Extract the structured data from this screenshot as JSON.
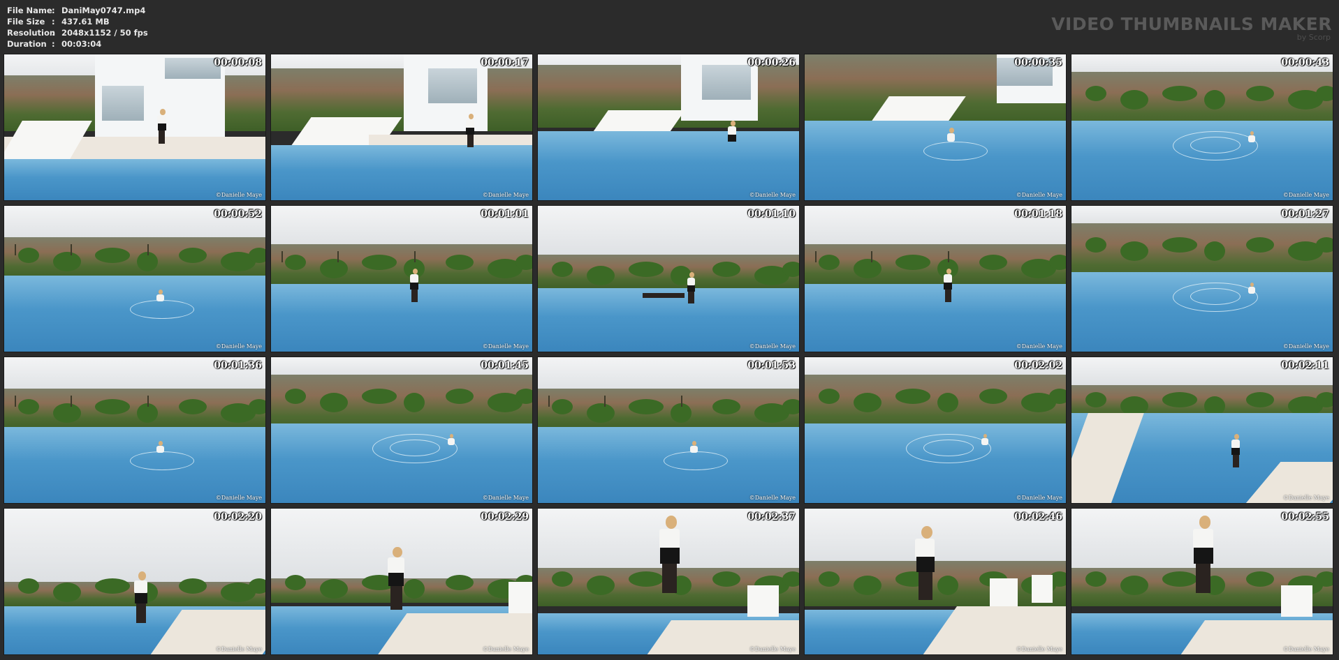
{
  "file_info": {
    "rows": [
      {
        "key": "File Name",
        "sep": ":",
        "value": "DaniMay0747.mp4"
      },
      {
        "key": "File Size",
        "sep": ":",
        "value": "437.61 MB"
      },
      {
        "key": "Resolution",
        "sep": ":",
        "value": "2048x1152 / 50 fps"
      },
      {
        "key": "Duration",
        "sep": ":",
        "value": "00:03:04"
      }
    ]
  },
  "brand": {
    "title": "VIDEO THUMBNAILS MAKER",
    "subtitle": "by Scorp"
  },
  "thumbnails": [
    {
      "timestamp": "00:00:08",
      "watermark": "©Danielle Maye",
      "scene": "house-standing"
    },
    {
      "timestamp": "00:00:17",
      "watermark": "©Danielle Maye",
      "scene": "house-steps"
    },
    {
      "timestamp": "00:00:26",
      "watermark": "©Danielle Maye",
      "scene": "house-wading"
    },
    {
      "timestamp": "00:00:35",
      "watermark": "©Danielle Maye",
      "scene": "house-deeper"
    },
    {
      "timestamp": "00:00:43",
      "watermark": "©Danielle Maye",
      "scene": "swim-ripple"
    },
    {
      "timestamp": "00:00:52",
      "watermark": "©Danielle Maye",
      "scene": "swim"
    },
    {
      "timestamp": "00:01:01",
      "watermark": "©Danielle Maye",
      "scene": "edge-sit"
    },
    {
      "timestamp": "00:01:10",
      "watermark": "©Danielle Maye",
      "scene": "edge-lounge"
    },
    {
      "timestamp": "00:01:18",
      "watermark": "©Danielle Maye",
      "scene": "edge-sit"
    },
    {
      "timestamp": "00:01:27",
      "watermark": "©Danielle Maye",
      "scene": "swim-ripple"
    },
    {
      "timestamp": "00:01:36",
      "watermark": "©Danielle Maye",
      "scene": "swim"
    },
    {
      "timestamp": "00:01:45",
      "watermark": "©Danielle Maye",
      "scene": "swim-ripple"
    },
    {
      "timestamp": "00:01:53",
      "watermark": "©Danielle Maye",
      "scene": "swim"
    },
    {
      "timestamp": "00:02:02",
      "watermark": "©Danielle Maye",
      "scene": "swim-ripple"
    },
    {
      "timestamp": "00:02:11",
      "watermark": "©Danielle Maye",
      "scene": "pool-corner"
    },
    {
      "timestamp": "00:02:20",
      "watermark": "©Danielle Maye",
      "scene": "stand-pool"
    },
    {
      "timestamp": "00:02:29",
      "watermark": "©Danielle Maye",
      "scene": "stand-back"
    },
    {
      "timestamp": "00:02:37",
      "watermark": "©Danielle Maye",
      "scene": "deck-walk"
    },
    {
      "timestamp": "00:02:46",
      "watermark": "©Danielle Maye",
      "scene": "deck-back"
    },
    {
      "timestamp": "00:02:55",
      "watermark": "©Danielle Maye",
      "scene": "deck-walk"
    }
  ]
}
